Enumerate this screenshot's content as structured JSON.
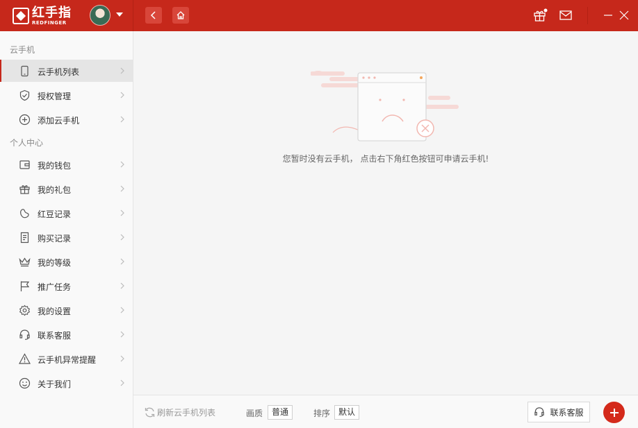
{
  "app": {
    "logo_cn": "红手指",
    "logo_en": "REDFINGER"
  },
  "sidebar": {
    "groups": [
      {
        "label": "云手机",
        "items": [
          {
            "label": "云手机列表",
            "icon": "phone-icon",
            "active": true
          },
          {
            "label": "授权管理",
            "icon": "shield-check-icon"
          },
          {
            "label": "添加云手机",
            "icon": "plus-circle-icon"
          }
        ]
      },
      {
        "label": "个人中心",
        "items": [
          {
            "label": "我的钱包",
            "icon": "wallet-icon"
          },
          {
            "label": "我的礼包",
            "icon": "gift-icon"
          },
          {
            "label": "红豆记录",
            "icon": "bean-icon"
          },
          {
            "label": "购买记录",
            "icon": "receipt-icon"
          },
          {
            "label": "我的等级",
            "icon": "crown-icon"
          },
          {
            "label": "推广任务",
            "icon": "flag-icon"
          },
          {
            "label": "我的设置",
            "icon": "gear-icon"
          },
          {
            "label": "联系客服",
            "icon": "headset-icon"
          },
          {
            "label": "云手机异常提醒",
            "icon": "warning-icon"
          },
          {
            "label": "关于我们",
            "icon": "smile-icon"
          }
        ]
      }
    ]
  },
  "main": {
    "empty_message": "您暂时没有云手机， 点击右下角红色按钮可申请云手机!"
  },
  "bottom": {
    "refresh_label": "刷新云手机列表",
    "quality_label": "画质",
    "quality_value": "普通",
    "sort_label": "排序",
    "sort_value": "默认",
    "support_label": "联系客服"
  },
  "colors": {
    "brand_red": "#c6281b",
    "add_button_red": "#d42a1b"
  }
}
